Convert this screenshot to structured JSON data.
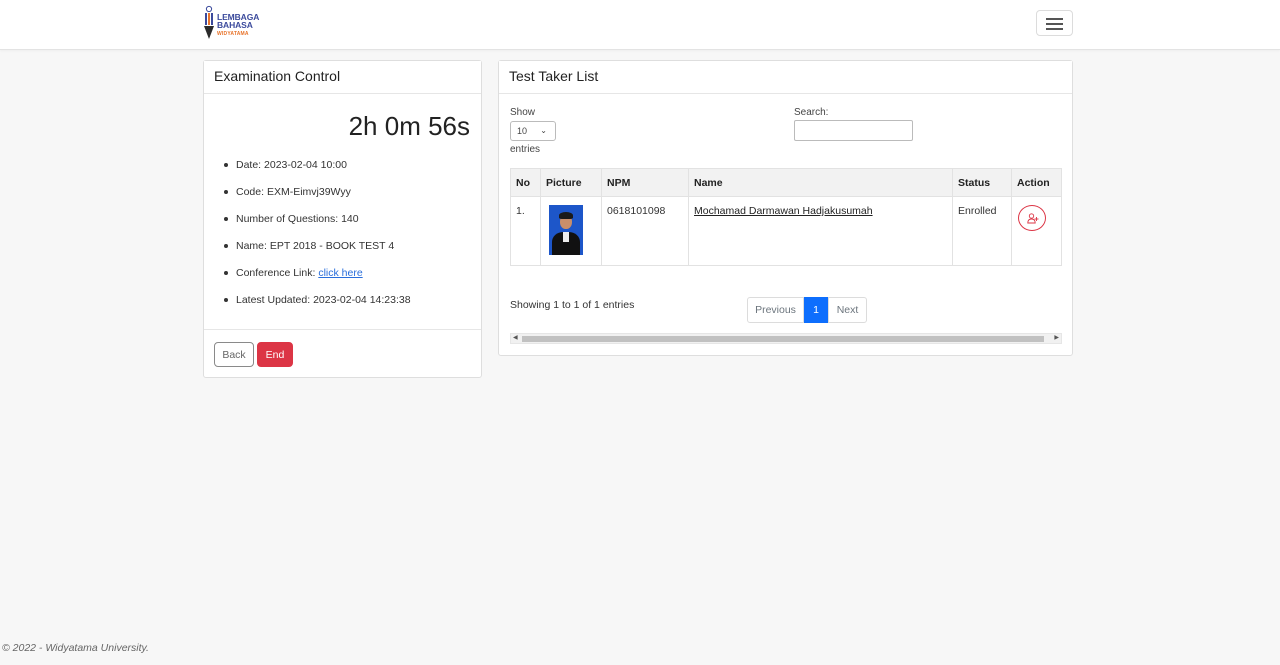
{
  "brand": {
    "line1": "LEMBAGA",
    "line2": "BAHASA",
    "line3": "WIDYATAMA"
  },
  "exam_control": {
    "title": "Examination Control",
    "timer": "2h 0m 56s",
    "details": [
      {
        "label": "Date:",
        "value": "2023-02-04 10:00"
      },
      {
        "label": "Code:",
        "value": "EXM-Eimvj39Wyy"
      },
      {
        "label": "Number of Questions:",
        "value": "140"
      },
      {
        "label": "Name:",
        "value": "EPT 2018 - BOOK TEST 4"
      },
      {
        "label": "Conference Link:",
        "link_text": "click here"
      },
      {
        "label": "Latest Updated:",
        "value": "2023-02-04 14:23:38"
      }
    ],
    "back_label": "Back",
    "end_label": "End"
  },
  "test_taker_list": {
    "title": "Test Taker List",
    "show_label": "Show",
    "page_length": "10",
    "entries_label": "entries",
    "search_label": "Search:",
    "search_value": "",
    "columns": [
      "No",
      "Picture",
      "NPM",
      "Name",
      "Status",
      "Action"
    ],
    "rows": [
      {
        "no": "1.",
        "npm": "0618101098",
        "name": "Mochamad Darmawan Hadjakusumah",
        "status": "Enrolled",
        "action_icon": "user-plus-icon"
      }
    ],
    "showing_text": "Showing 1 to 1 of 1 entries",
    "pagination": {
      "previous": "Previous",
      "current": "1",
      "next": "Next"
    }
  },
  "footer": {
    "text": "© 2022 - Widyatama University."
  },
  "colors": {
    "danger": "#dc3545",
    "primary": "#0d6efd",
    "background": "#f7f7f7"
  }
}
